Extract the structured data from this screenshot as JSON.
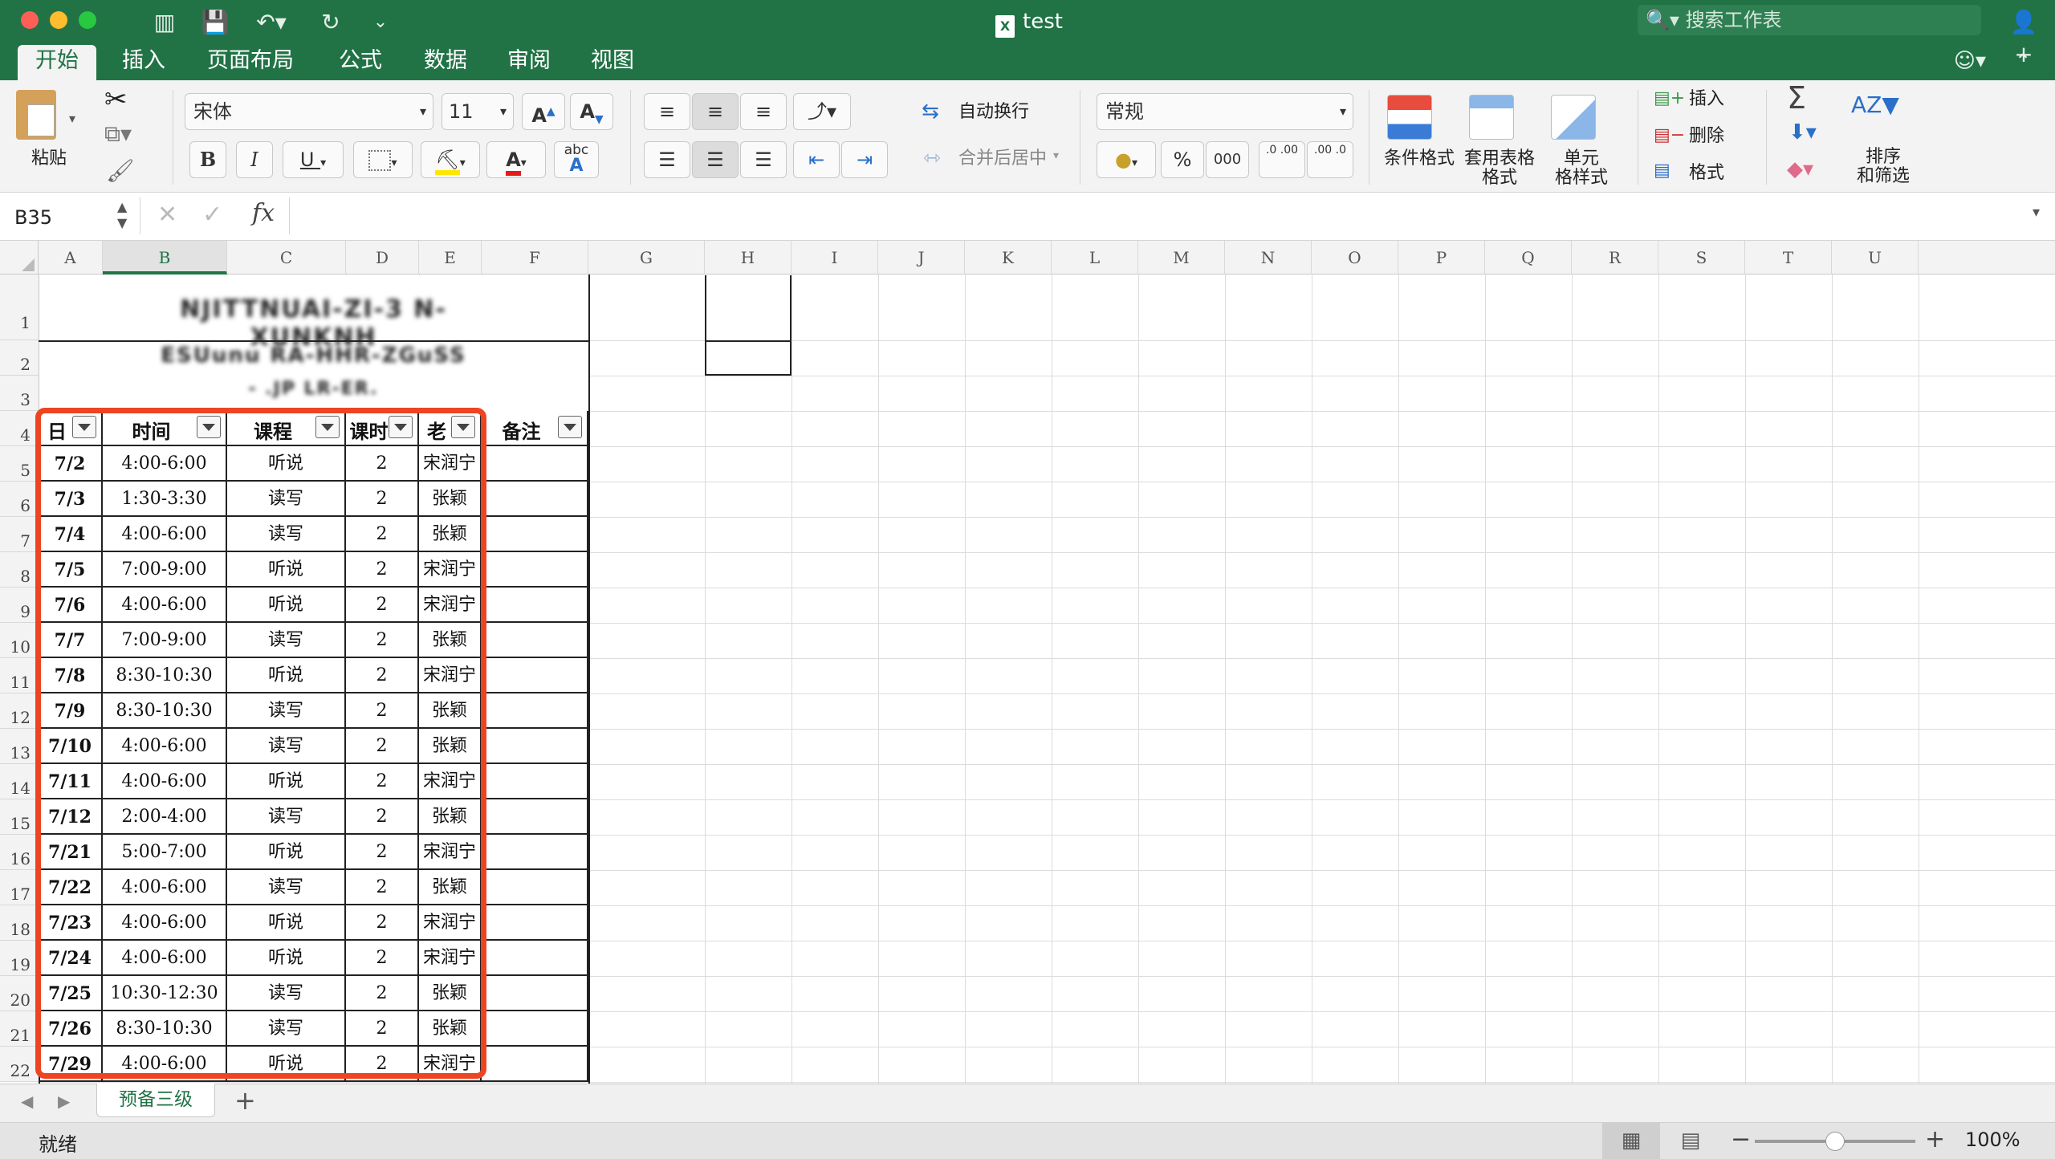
{
  "window": {
    "title": "test",
    "search_placeholder": "搜索工作表"
  },
  "ribbon_tabs": [
    "开始",
    "插入",
    "页面布局",
    "公式",
    "数据",
    "审阅",
    "视图"
  ],
  "ribbon": {
    "paste_label": "粘贴",
    "font_name": "宋体",
    "font_size": "11",
    "bold": "B",
    "italic": "I",
    "underline": "U",
    "grow_font": "A",
    "shrink_font": "A",
    "font_color": "A",
    "phonetic": "abc",
    "wrap_text": "自动换行",
    "merge_center": "合并后居中",
    "number_format": "常规",
    "percent": "%",
    "comma": "000",
    "increase_decimal": ".0 .00",
    "decrease_decimal": ".00 .0",
    "conditional_format": "条件格式",
    "format_as_table": "套用表格\n格式",
    "cell_styles": "单元\n格样式",
    "insert": "插入",
    "delete": "删除",
    "format": "格式",
    "sort_filter": "排序\n和筛选",
    "sum_icon": "Σ"
  },
  "formula_bar": {
    "name_box": "B35",
    "fx": "fx",
    "value": ""
  },
  "columns": [
    "A",
    "B",
    "C",
    "D",
    "E",
    "F",
    "G",
    "H",
    "I",
    "J",
    "K",
    "L",
    "M",
    "N",
    "O",
    "P",
    "Q",
    "R",
    "S",
    "T",
    "U"
  ],
  "rows": [
    "1",
    "2",
    "3",
    "4",
    "5",
    "6",
    "7",
    "8",
    "9",
    "10",
    "11",
    "12",
    "13",
    "14",
    "15",
    "16",
    "17",
    "18",
    "19",
    "20",
    "21",
    "22"
  ],
  "header_blurred": {
    "line1": "NJITTNUAI-ZI-3 N-XUNKNH",
    "line2": "ESUunu RA-HHR-ZGuSS",
    "line3": "- .JP LR-ER."
  },
  "table_headers": [
    "日期",
    "时间",
    "课程",
    "课时",
    "老师",
    "备注"
  ],
  "table_rows": [
    [
      "7/2",
      "4:00-6:00",
      "听说",
      "2",
      "宋润宁",
      ""
    ],
    [
      "7/3",
      "1:30-3:30",
      "读写",
      "2",
      "张颖",
      ""
    ],
    [
      "7/4",
      "4:00-6:00",
      "读写",
      "2",
      "张颖",
      ""
    ],
    [
      "7/5",
      "7:00-9:00",
      "听说",
      "2",
      "宋润宁",
      ""
    ],
    [
      "7/6",
      "4:00-6:00",
      "听说",
      "2",
      "宋润宁",
      ""
    ],
    [
      "7/7",
      "7:00-9:00",
      "读写",
      "2",
      "张颖",
      ""
    ],
    [
      "7/8",
      "8:30-10:30",
      "听说",
      "2",
      "宋润宁",
      ""
    ],
    [
      "7/9",
      "8:30-10:30",
      "读写",
      "2",
      "张颖",
      ""
    ],
    [
      "7/10",
      "4:00-6:00",
      "读写",
      "2",
      "张颖",
      ""
    ],
    [
      "7/11",
      "4:00-6:00",
      "听说",
      "2",
      "宋润宁",
      ""
    ],
    [
      "7/12",
      "2:00-4:00",
      "读写",
      "2",
      "张颖",
      ""
    ],
    [
      "7/21",
      "5:00-7:00",
      "听说",
      "2",
      "宋润宁",
      ""
    ],
    [
      "7/22",
      "4:00-6:00",
      "读写",
      "2",
      "张颖",
      ""
    ],
    [
      "7/23",
      "4:00-6:00",
      "听说",
      "2",
      "宋润宁",
      ""
    ],
    [
      "7/24",
      "4:00-6:00",
      "听说",
      "2",
      "宋润宁",
      ""
    ],
    [
      "7/25",
      "10:30-12:30",
      "读写",
      "2",
      "张颖",
      ""
    ],
    [
      "7/26",
      "8:30-10:30",
      "读写",
      "2",
      "张颖",
      ""
    ],
    [
      "7/29",
      "4:00-6:00",
      "听说",
      "2",
      "宋润宁",
      ""
    ]
  ],
  "sheet_tabs": [
    "预备三级"
  ],
  "status": {
    "ready": "就绪",
    "zoom": "100%",
    "zoom_fraction": 0.5
  },
  "colors": {
    "accent": "#217346",
    "highlight_border": "#ee4422"
  }
}
